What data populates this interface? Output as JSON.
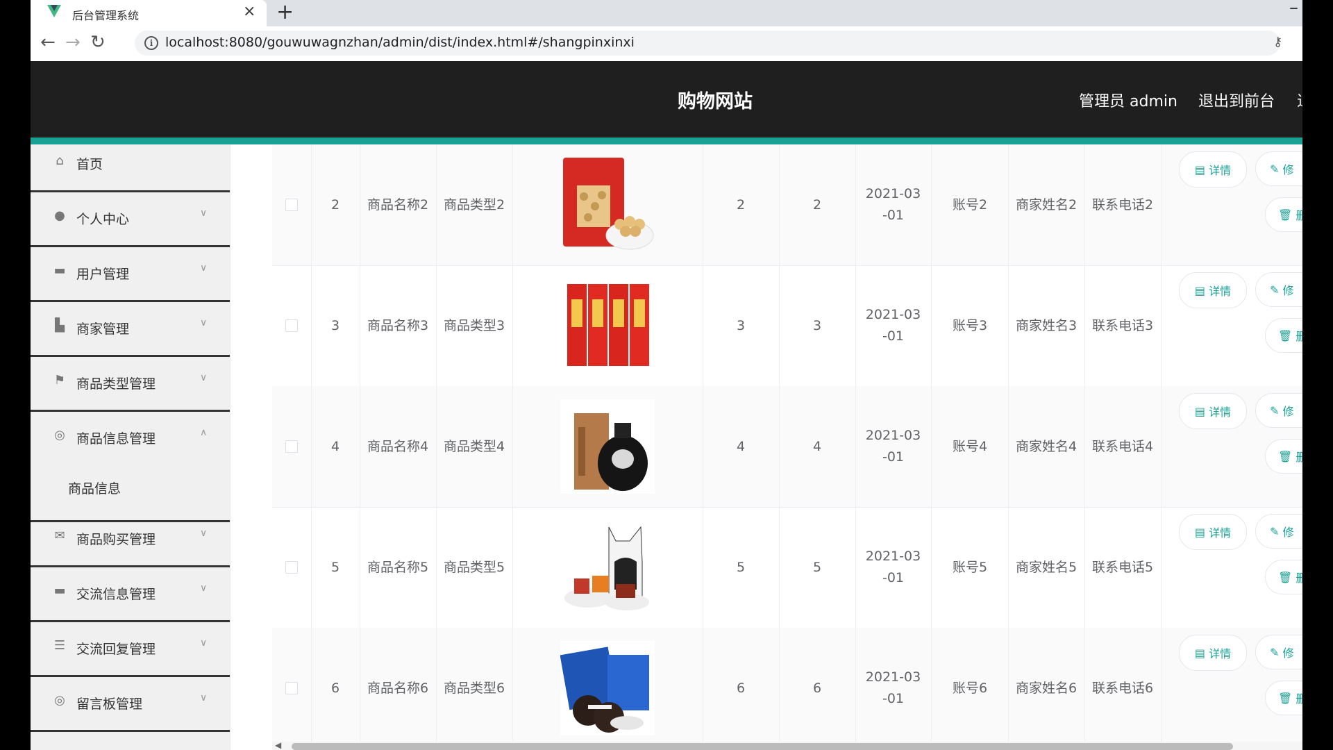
{
  "browser": {
    "tab_title": "后台管理系统",
    "tab_close": "×",
    "new_tab": "+",
    "url": "localhost:8080/gouwuwagnzhan/admin/dist/index.html#/shangpinxinxi"
  },
  "header": {
    "site_title": "购物网站",
    "admin": "管理员 admin",
    "logout": "退出到前台",
    "extra": "退"
  },
  "sidebar": {
    "items": [
      {
        "label": "首页",
        "icon": "home-icon"
      },
      {
        "label": "个人中心",
        "icon": "user-icon"
      },
      {
        "label": "用户管理",
        "icon": "user-manage-icon"
      },
      {
        "label": "商家管理",
        "icon": "merchant-icon"
      },
      {
        "label": "商品类型管理",
        "icon": "flag-icon"
      },
      {
        "label": "商品信息管理",
        "icon": "info-icon"
      },
      {
        "label": "商品购买管理",
        "icon": "mail-icon"
      },
      {
        "label": "交流信息管理",
        "icon": "chat-icon"
      },
      {
        "label": "交流回复管理",
        "icon": "sliders-icon"
      },
      {
        "label": "留言板管理",
        "icon": "message-board-icon"
      }
    ],
    "submenu_label": "商品信息"
  },
  "table": {
    "rows": [
      {
        "index": "2",
        "name": "商品名称2",
        "type": "商品类型2",
        "price": "2",
        "stock": "2",
        "date": "2021-03-01",
        "account": "账号2",
        "merchant": "商家姓名2",
        "phone": "联系电话2"
      },
      {
        "index": "3",
        "name": "商品名称3",
        "type": "商品类型3",
        "price": "3",
        "stock": "3",
        "date": "2021-03-01",
        "account": "账号3",
        "merchant": "商家姓名3",
        "phone": "联系电话3"
      },
      {
        "index": "4",
        "name": "商品名称4",
        "type": "商品类型4",
        "price": "4",
        "stock": "4",
        "date": "2021-03-01",
        "account": "账号4",
        "merchant": "商家姓名4",
        "phone": "联系电话4"
      },
      {
        "index": "5",
        "name": "商品名称5",
        "type": "商品类型5",
        "price": "5",
        "stock": "5",
        "date": "2021-03-01",
        "account": "账号5",
        "merchant": "商家姓名5",
        "phone": "联系电话5"
      },
      {
        "index": "6",
        "name": "商品名称6",
        "type": "商品类型6",
        "price": "6",
        "stock": "6",
        "date": "2021-03-01",
        "account": "账号6",
        "merchant": "商家姓名6",
        "phone": "联系电话6"
      }
    ],
    "actions": {
      "detail": "详情",
      "edit": "修",
      "delete": "删"
    }
  },
  "colors": {
    "accent": "#1aa195",
    "header_bg": "#1f1f1f"
  }
}
